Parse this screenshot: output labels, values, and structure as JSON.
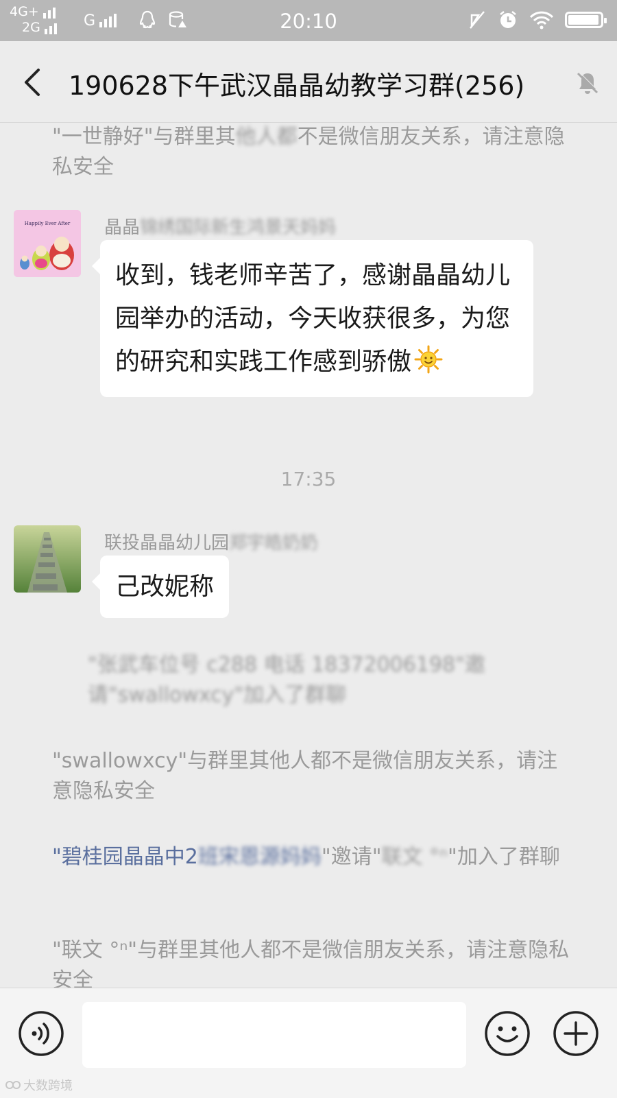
{
  "status_bar": {
    "network_top": "4G+",
    "network_bottom": "2G",
    "network_g": "G",
    "time": "20:10",
    "battery_level": 0.95
  },
  "header": {
    "title": "190628下午武汉晶晶幼教学习群(256)",
    "back_icon": "chevron-left-icon",
    "mute_icon": "bell-muted-icon"
  },
  "messages": {
    "sys1": {
      "prefix": "\"一世静好\"与群里其",
      "blurred": "他人都",
      "suffix": "不是微信朋友关系，请注意隐私安全"
    },
    "msg1": {
      "sender_visible": "晶晶",
      "sender_blurred": "锦绣国际新生鸿景天妈妈",
      "text": "收到，钱老师辛苦了，感谢晶晶幼儿园举办的活动，今天收获很多，为您的研究和实践工作感到骄傲",
      "emoji": "sun-emoji"
    },
    "timestamp": "17:35",
    "msg2": {
      "sender_visible": "联投晶晶幼儿园",
      "sender_blurred": "郑宇皓奶奶",
      "text": "己改妮称"
    },
    "sys2": {
      "text": "\"张武车位号 c288  电话 18372006198\"邀请\"swallowxcy\"加入了群聊"
    },
    "sys3": {
      "text": "\"swallowxcy\"与群里其他人都不是微信朋友关系，请注意隐私安全"
    },
    "sys4": {
      "q1": "\"",
      "name_visible": "碧桂园晶晶中2",
      "name_blurred": "班宋恩源妈妈",
      "q2": "\"邀请\"",
      "invitee_blurred": "联文  °ⁿ",
      "rest": "\"加入了群聊"
    },
    "sys5": {
      "text": "\"联文 °ⁿ\"与群里其他人都不是微信朋友关系，请注意隐私安全"
    }
  },
  "input_bar": {
    "placeholder": "",
    "voice_icon": "voice-icon",
    "emoji_icon": "emoji-icon",
    "plus_icon": "plus-icon"
  },
  "watermark": "大数跨境"
}
